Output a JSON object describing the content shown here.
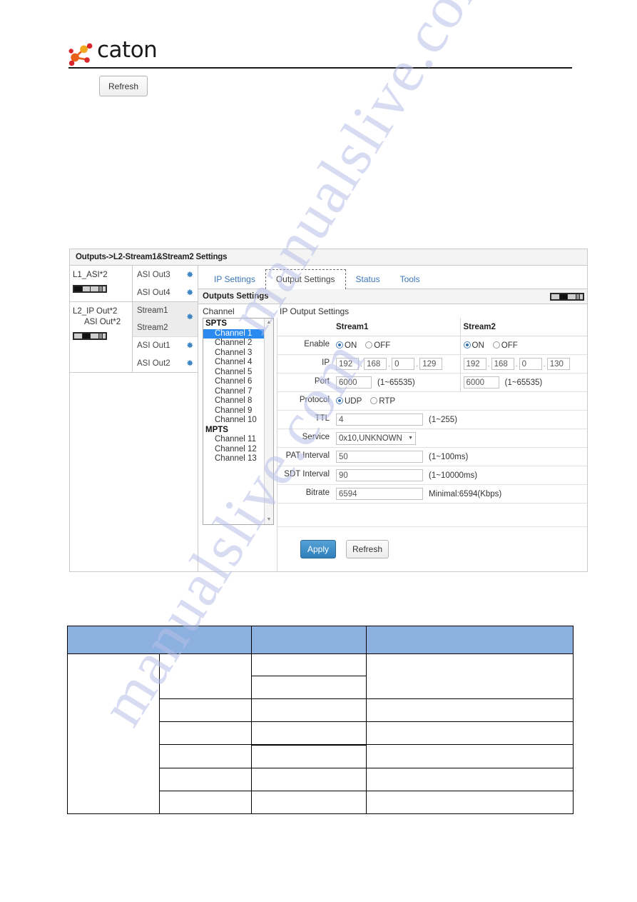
{
  "brand": {
    "name": "caton",
    "logo_icon": "caton-molecule-logo",
    "logo_colors": [
      "#d9262c",
      "#e8601c",
      "#f0a81e"
    ]
  },
  "top_toolbar": {
    "refresh_label": "Refresh"
  },
  "watermark": {
    "line1": "manualslive.com",
    "line2": "manualslive.com",
    "color": "#b9c0e8"
  },
  "panel": {
    "title": "Outputs->L2-Stream1&Stream2 Settings",
    "device_tree": {
      "blocks": [
        {
          "name": "L1_ASI*2",
          "name2": "",
          "meter_icon": "level-meter-icon",
          "ports": [
            {
              "label": "ASI Out3",
              "gear_icon": "gear-icon",
              "selected": false
            },
            {
              "label": "ASI Out4",
              "gear_icon": "gear-icon",
              "selected": false
            }
          ]
        },
        {
          "name": "L2_IP Out*2",
          "name2": "ASI Out*2",
          "meter_icon": "level-meter-icon",
          "ports": [
            {
              "label": "Stream1",
              "gear_icon": "gear-icon",
              "selected": true
            },
            {
              "label": "Stream2",
              "gear_icon": "",
              "selected": true
            },
            {
              "label": "ASI Out1",
              "gear_icon": "gear-icon",
              "selected": false
            },
            {
              "label": "ASI Out2",
              "gear_icon": "gear-icon",
              "selected": false
            }
          ]
        }
      ]
    },
    "tabs": [
      {
        "label": "IP Settings",
        "active": false
      },
      {
        "label": "Output Settings",
        "active": true
      },
      {
        "label": "Status",
        "active": false
      },
      {
        "label": "Tools",
        "active": false
      }
    ],
    "sub_header": {
      "title": "Outputs Settings",
      "meter_icon": "level-meter-icon"
    },
    "columns": {
      "channel_header": "Channel",
      "settings_header": "IP Output Settings"
    },
    "channel_list": {
      "scroll_up_icon": "scroll-up-arrow",
      "scroll_down_icon": "scroll-down-arrow",
      "groups": [
        {
          "group": "SPTS",
          "items": [
            {
              "label": "Channel 1",
              "selected": true
            },
            {
              "label": "Channel 2",
              "selected": false
            },
            {
              "label": "Channel 3",
              "selected": false
            },
            {
              "label": "Channel 4",
              "selected": false
            },
            {
              "label": "Channel 5",
              "selected": false
            },
            {
              "label": "Channel 6",
              "selected": false
            },
            {
              "label": "Channel 7",
              "selected": false
            },
            {
              "label": "Channel 8",
              "selected": false
            },
            {
              "label": "Channel 9",
              "selected": false
            },
            {
              "label": "Channel 10",
              "selected": false
            }
          ]
        },
        {
          "group": "MPTS",
          "items": [
            {
              "label": "Channel 11",
              "selected": false
            },
            {
              "label": "Channel 12",
              "selected": false
            },
            {
              "label": "Channel 13",
              "selected": false
            }
          ]
        }
      ]
    },
    "form": {
      "stream1_header": "Stream1",
      "stream2_header": "Stream2",
      "labels": {
        "enable": "Enable",
        "ip": "IP",
        "port": "Port",
        "protocol": "Protocol",
        "ttl": "TTL",
        "service": "Service",
        "pat_interval": "PAT Interval",
        "sdt_interval": "SDT Interval",
        "bitrate": "Bitrate"
      },
      "enable": {
        "on_label": "ON",
        "off_label": "OFF",
        "stream1_value": "ON",
        "stream2_value": "ON"
      },
      "ip": {
        "stream1": [
          "192",
          "168",
          "0",
          "129"
        ],
        "stream2": [
          "192",
          "168",
          "0",
          "130"
        ]
      },
      "port": {
        "stream1": "6000",
        "stream2": "6000",
        "range": "(1~65535)"
      },
      "protocol": {
        "udp_label": "UDP",
        "rtp_label": "RTP",
        "value": "UDP"
      },
      "ttl": {
        "value": "4",
        "range": "(1~255)"
      },
      "service": {
        "value": "0x10,UNKNOWN",
        "caret_icon": "chevron-down-icon"
      },
      "pat_interval": {
        "value": "50",
        "range": "(1~100ms)"
      },
      "sdt_interval": {
        "value": "90",
        "range": "(1~10000ms)"
      },
      "bitrate": {
        "value": "6594",
        "note": "Minimal:6594(Kbps)"
      }
    },
    "buttons": {
      "apply_label": "Apply",
      "refresh_label": "Refresh",
      "apply_color": "#2e7fbb"
    }
  },
  "spec_table": {
    "header_color": "#8cb0e0",
    "headers": [
      "",
      "",
      ""
    ],
    "rows": [
      {
        "cells": [
          "",
          "",
          "",
          ""
        ]
      },
      {
        "cells": [
          "",
          "",
          "",
          ""
        ]
      },
      {
        "cells": [
          "",
          "",
          "",
          ""
        ]
      },
      {
        "cells": [
          "",
          "",
          "",
          ""
        ]
      },
      {
        "cells": [
          "",
          "",
          "",
          ""
        ]
      },
      {
        "cells": [
          "",
          "",
          "",
          ""
        ]
      },
      {
        "cells": [
          "",
          "",
          "",
          ""
        ]
      },
      {
        "cells": [
          "",
          "",
          "",
          ""
        ]
      }
    ]
  }
}
